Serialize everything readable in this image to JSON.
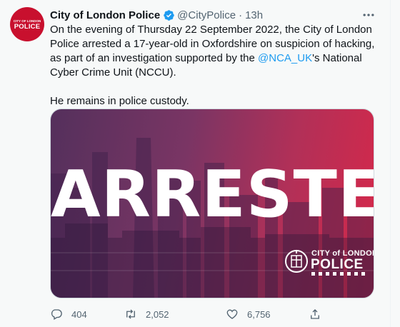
{
  "tweet": {
    "avatar": {
      "top_text": "CITY OF LONDON",
      "main_text": "POLICE",
      "color": "#c8102e"
    },
    "author_name": "City of London Police",
    "verified_icon": "verified-badge-icon",
    "handle": "@CityPolice",
    "separator": "·",
    "time": "13h",
    "more_icon": "more-horizontal-icon",
    "text": {
      "p1_before_mention": "On the evening of Thursday 22 September 2022, the City of London Police arrested a 17-year-old in Oxfordshire on suspicion of hacking, as part of an investigation supported by the ",
      "mention": "@NCA_UK",
      "p1_after_mention": "'s National Cyber Crime Unit (NCCU).",
      "p2": "He remains in police custody."
    },
    "media": {
      "headline": "ARRESTED",
      "logo_top": "CITY of LONDON",
      "logo_main": "POLICE"
    },
    "actions": {
      "reply_count": "404",
      "retweet_count": "2,052",
      "like_count": "6,756"
    }
  },
  "colors": {
    "link": "#1d9bf0",
    "muted": "#536471",
    "text": "#0f1419",
    "background": "#f7f9f9"
  }
}
